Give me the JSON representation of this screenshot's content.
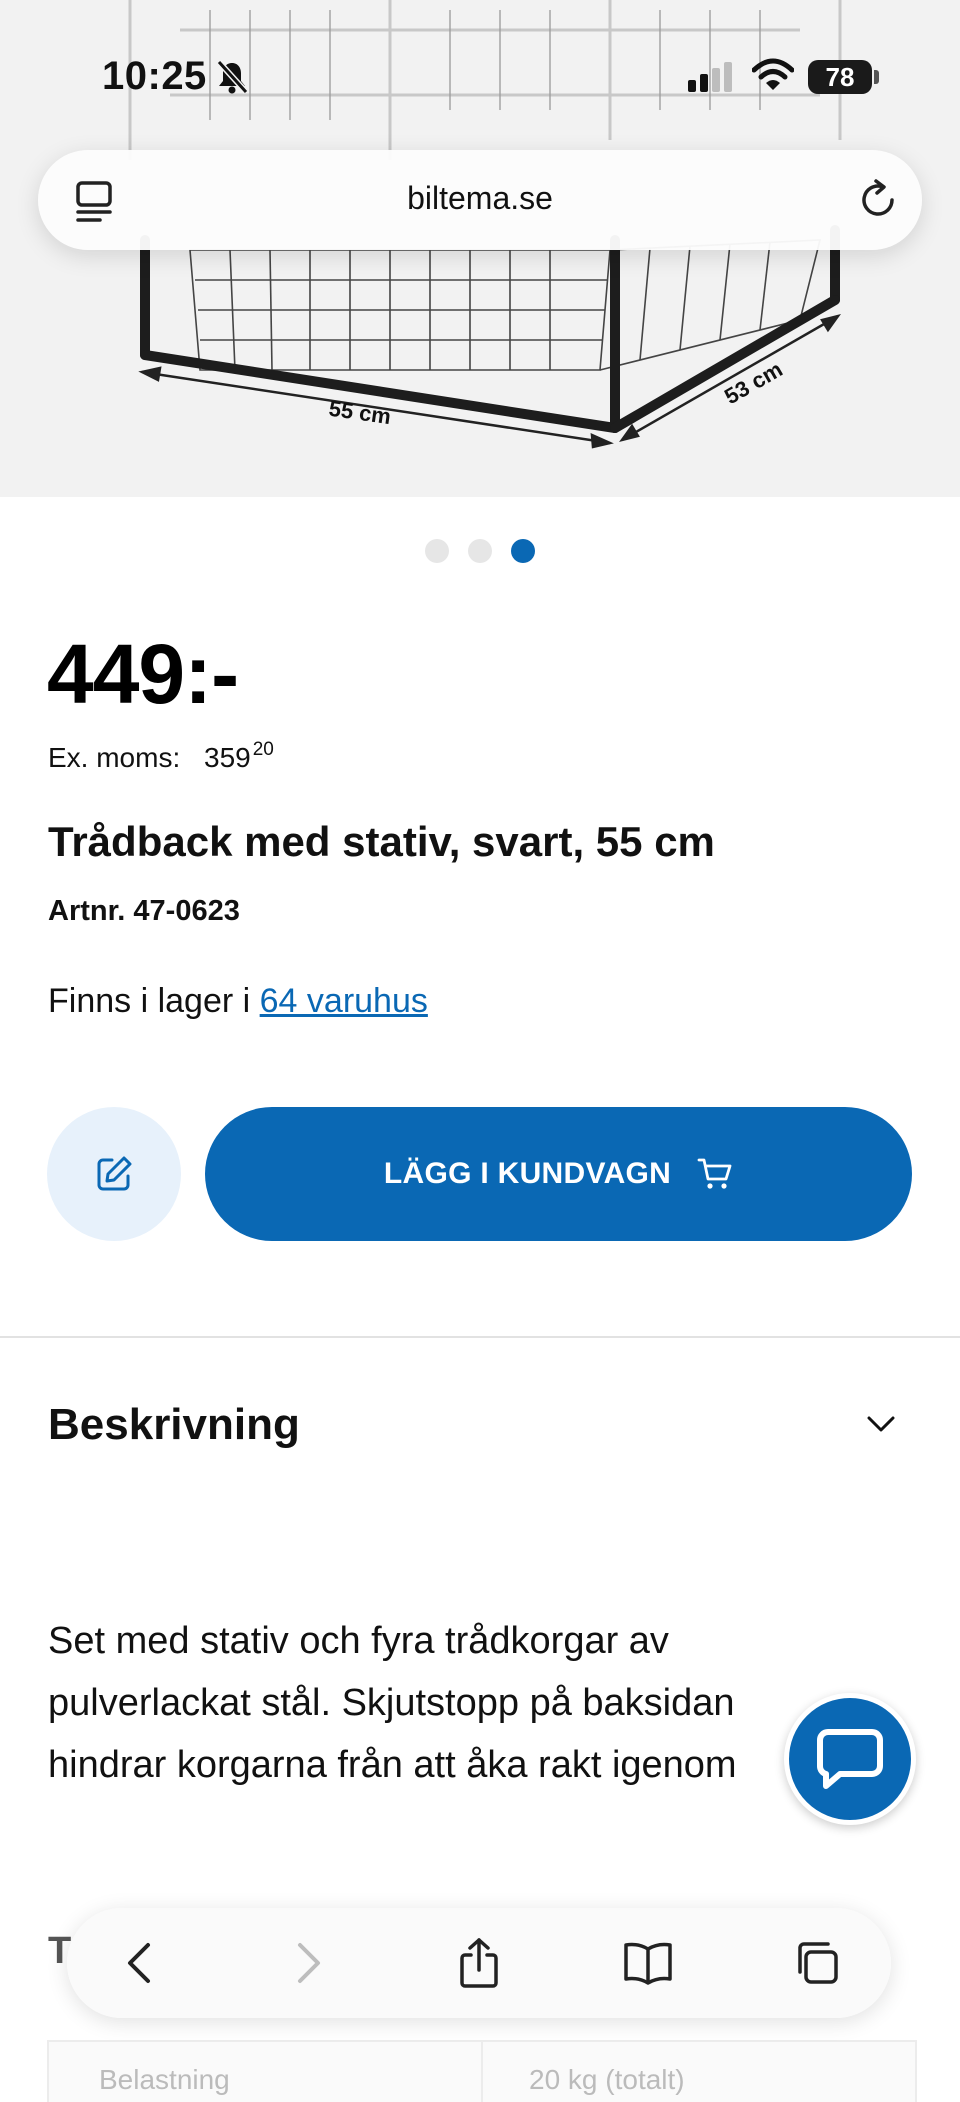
{
  "status_bar": {
    "time": "10:25",
    "battery": "78"
  },
  "address_bar": {
    "url": "biltema.se"
  },
  "hero": {
    "dim_width": "55 cm",
    "dim_depth": "53 cm"
  },
  "product": {
    "price": "449:-",
    "ex_moms_label": "Ex. moms:",
    "ex_moms_value": "359",
    "ex_moms_decimals": "20",
    "title": "Trådback med stativ, svart, 55 cm",
    "artnr": "Artnr. 47-0623",
    "stock_prefix": "Finns i lager i ",
    "stock_link": "64 varuhus"
  },
  "actions": {
    "add_to_cart": "LÄGG I KUNDVAGN"
  },
  "description": {
    "heading": "Beskrivning",
    "text": "Set med stativ och fyra trådkorgar av pulverlackat stål. Skjutstopp på baksidan hindrar korgarna från att åka rakt igenom"
  },
  "peek": {
    "heading_initial": "T",
    "table_label": "Belastning",
    "table_value": "20 kg (totalt)"
  },
  "carousel": {
    "count": 3,
    "active": 2
  },
  "colors": {
    "brand_blue": "#0a68b4",
    "fav_bg": "#e7f1fb"
  }
}
